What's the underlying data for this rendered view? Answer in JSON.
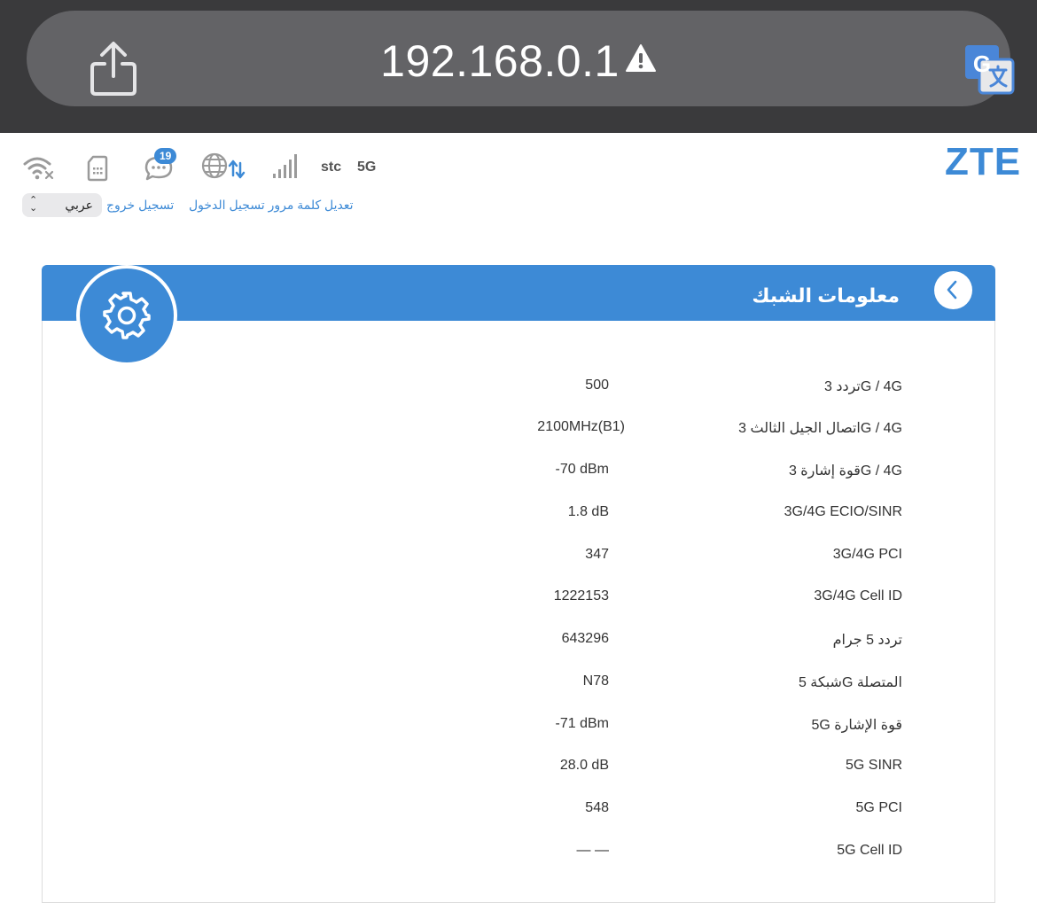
{
  "browser": {
    "url": "192.168.0.1"
  },
  "header": {
    "logo": "ZTE",
    "sms_count": "19",
    "operator": "stc",
    "network_type": "5G",
    "language_value": "عربي",
    "logout_label": "تسجيل خروج",
    "change_password_label": "تعديل كلمة مرور تسجيل الدخول"
  },
  "panel": {
    "title": "معلومات الشبك",
    "rows": [
      {
        "label": "تردد 3G / 4G",
        "value": "500"
      },
      {
        "label": "اتصال الجيل الثالث 3G / 4G",
        "value": "2100MHz(B1)"
      },
      {
        "label": "قوة إشارة 3G / 4G",
        "value": "-70 dBm"
      },
      {
        "label": "3G/4G ECIO/SINR",
        "value": "1.8 dB"
      },
      {
        "label": "3G/4G PCI",
        "value": "347"
      },
      {
        "label": "3G/4G Cell ID",
        "value": "1222153"
      },
      {
        "label": "تردد 5 جرام",
        "value": "643296"
      },
      {
        "label": "شبكة 5G المتصلة",
        "value": "N78"
      },
      {
        "label": "5G قوة الإشارة",
        "value": "-71 dBm"
      },
      {
        "label": "5G SINR",
        "value": "28.0 dB"
      },
      {
        "label": "5G PCI",
        "value": "548"
      },
      {
        "label": "5G Cell ID",
        "value": "— —"
      }
    ]
  },
  "colors": {
    "accent": "#3d8ad6",
    "browser_bar": "#3a3a3c",
    "url_pill": "#636366"
  }
}
